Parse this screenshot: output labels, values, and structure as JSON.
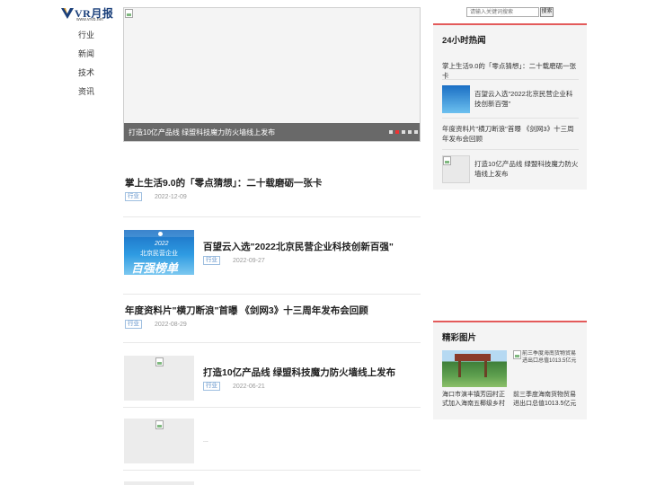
{
  "brand": {
    "name": "VR月报",
    "url": "www.vrvb.net",
    "accent": "#1a3f7a"
  },
  "nav": {
    "items": [
      {
        "label": "行业"
      },
      {
        "label": "新闻"
      },
      {
        "label": "技术"
      },
      {
        "label": "资讯"
      }
    ]
  },
  "slider": {
    "caption": "打造10亿产品线 绿盟科技魔力防火墙线上发布",
    "dot_count": 5,
    "active_dot": 1
  },
  "articles": [
    {
      "title": "掌上生活9.0的「零点猜想」：二十载磨砺一张卡",
      "tag": "行业",
      "date": "2022-12-09",
      "thumb": "none"
    },
    {
      "title": "百望云入选\"2022北京民营企业科技创新百强\"",
      "tag": "行业",
      "date": "2022-09-27",
      "thumb": "banner",
      "thumb_text": {
        "year": "2022",
        "line": "北京民营企业",
        "big": "百强榜单"
      }
    },
    {
      "title": "年度资料片\"横刀断浪\"首曝 《剑网3》十三周年发布会回顾",
      "tag": "行业",
      "date": "2022-08-29",
      "thumb": "none"
    },
    {
      "title": "打造10亿产品线 绿盟科技魔力防火墙线上发布",
      "tag": "行业",
      "date": "2022-06-21",
      "thumb": "broken"
    },
    {
      "title": "",
      "tag": "",
      "date": "...",
      "thumb": "broken"
    }
  ],
  "search": {
    "placeholder": "请输入关键词搜索",
    "button": "搜索"
  },
  "hot": {
    "title": "24小时热闻",
    "items": [
      "掌上生活9.0的「零点猜想」：二十载磨砺一张卡",
      "百望云入选\"2022北京民营企业科技创新百强\"",
      "年度资料片\"横刀断浪\"首曝 《剑网3》十三周年发布会回顾",
      "打造10亿产品线 绿盟科技魔力防火墙线上发布"
    ]
  },
  "pictures": {
    "title": "精彩图片",
    "items": [
      {
        "caption": "海口市演丰镇芳园村正式加入海南五椰级乡村",
        "alt": ""
      },
      {
        "caption": "前三季度海南货物贸易进出口总值1013.5亿元",
        "alt": "前三季度海南货物贸易进出口总值1013.5亿元"
      }
    ]
  },
  "colors": {
    "panel_accent": "#e35a5a",
    "tag": "#5b8ec7",
    "active_dot": "#e33333"
  }
}
